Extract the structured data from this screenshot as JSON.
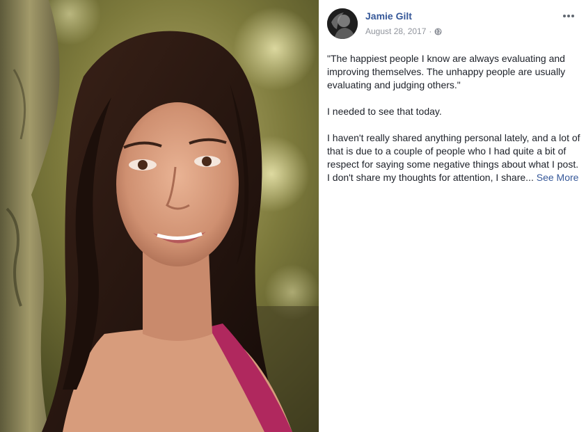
{
  "post": {
    "author": "Jamie Gilt",
    "date": "August 28, 2017",
    "separator": "·",
    "privacy_icon": "globe-icon",
    "more_icon": "more-options-icon",
    "paragraphs": [
      "\"The happiest people I know are always evaluating and improving themselves. The unhappy people are usually evaluating and judging others.\"",
      "I needed to see that today."
    ],
    "truncated_paragraph": "I haven't really shared anything personal lately, and a lot of that is due to a couple of people who I had quite a bit of respect for saying some negative things about what I post. I don't share my thoughts for attention, I share...",
    "see_more": "See More"
  },
  "photo": {
    "subject": "portrait-photo"
  },
  "colors": {
    "link": "#365899",
    "text": "#1d2129",
    "meta": "#90949c"
  }
}
